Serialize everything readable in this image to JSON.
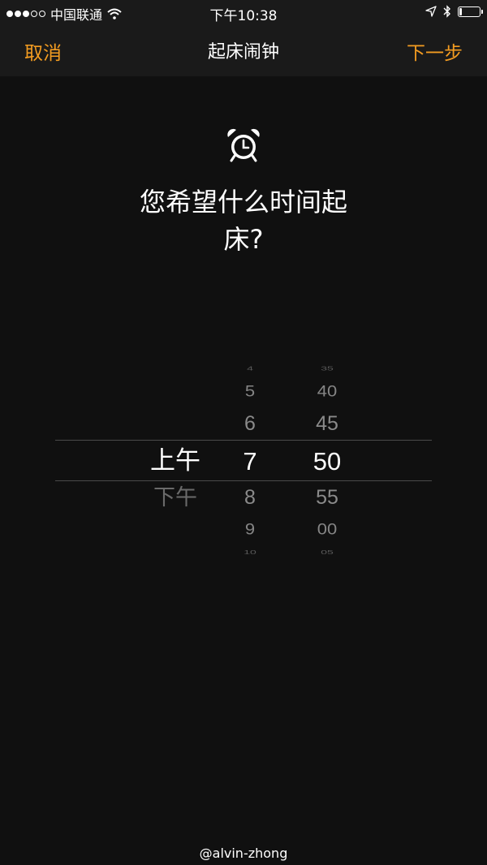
{
  "status_bar": {
    "carrier": "中国联通",
    "time": "下午10:38",
    "signal_dots_filled": 3,
    "signal_dots_total": 5,
    "battery_level": 0.15
  },
  "nav": {
    "cancel_label": "取消",
    "title": "起床闹钟",
    "next_label": "下一步",
    "accent_color": "#f39c21"
  },
  "prompt": {
    "icon": "alarm-clock-icon",
    "question_line1": "您希望什么时间起",
    "question_line2": "床?"
  },
  "picker": {
    "ampm": {
      "selected": "上午",
      "below": "下午"
    },
    "hours": {
      "above": [
        "4",
        "5",
        "6"
      ],
      "selected": "7",
      "below": [
        "8",
        "9",
        "10"
      ]
    },
    "minutes": {
      "above": [
        "35",
        "40",
        "45"
      ],
      "selected": "50",
      "below": [
        "55",
        "00",
        "05"
      ]
    }
  },
  "watermark": "@alvin-zhong"
}
